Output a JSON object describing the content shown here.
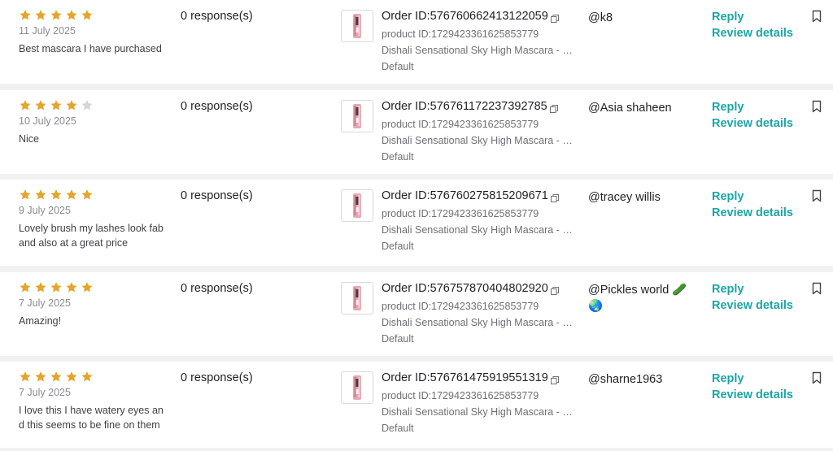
{
  "colors": {
    "star_filled": "#e3a52b",
    "star_empty": "#d4d5d9",
    "link": "#1ba5a6",
    "separator": "#f1f1f2"
  },
  "icons": {
    "star": "star-icon",
    "copy": "copy-icon",
    "bookmark": "bookmark-icon"
  },
  "reviews": [
    {
      "rating": 5,
      "date": "11 July 2025",
      "text": "Best mascara I have purchased",
      "responses": "0 response(s)",
      "order_prefix": "Order ID:",
      "order_id": "576760662413122059",
      "product_id": "product ID:1729423361625853779",
      "product_name": "Dishali Sensational Sky High Mascara - E...",
      "variant": "Default",
      "user": "@k8",
      "reply_label": "Reply",
      "details_label": "Review details"
    },
    {
      "rating": 4,
      "date": "10 July 2025",
      "text": "Nice",
      "responses": "0 response(s)",
      "order_prefix": "Order ID:",
      "order_id": "576761172237392785",
      "product_id": "product ID:1729423361625853779",
      "product_name": "Dishali Sensational Sky High Mascara - E...",
      "variant": "Default",
      "user": "@Asia shaheen",
      "reply_label": "Reply",
      "details_label": "Review details"
    },
    {
      "rating": 5,
      "date": "9 July 2025",
      "text": "Lovely brush my lashes look fab and also at a great price",
      "responses": "0 response(s)",
      "order_prefix": "Order ID:",
      "order_id": "576760275815209671",
      "product_id": "product ID:1729423361625853779",
      "product_name": "Dishali Sensational Sky High Mascara - E...",
      "variant": "Default",
      "user": "@tracey willis",
      "reply_label": "Reply",
      "details_label": "Review details"
    },
    {
      "rating": 5,
      "date": "7 July 2025",
      "text": "Amazing!",
      "responses": "0 response(s)",
      "order_prefix": "Order ID:",
      "order_id": "576757870404802920",
      "product_id": "product ID:1729423361625853779",
      "product_name": "Dishali Sensational Sky High Mascara - E...",
      "variant": "Default",
      "user": "@Pickles world 🥒 🌏",
      "reply_label": "Reply",
      "details_label": "Review details"
    },
    {
      "rating": 5,
      "date": "7 July 2025",
      "text": "I love this I have watery eyes an d this seems to be fine on them",
      "responses": "0 response(s)",
      "order_prefix": "Order ID:",
      "order_id": "576761475919551319",
      "product_id": "product ID:1729423361625853779",
      "product_name": "Dishali Sensational Sky High Mascara - E...",
      "variant": "Default",
      "user": "@sharne1963",
      "reply_label": "Reply",
      "details_label": "Review details"
    }
  ]
}
